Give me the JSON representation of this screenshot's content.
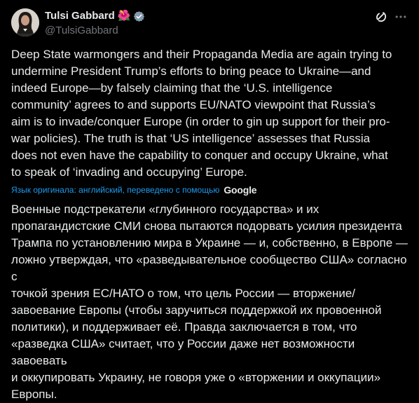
{
  "author": {
    "display_name": "Tulsi Gabbard",
    "flag_emoji": "🌺",
    "handle": "@TulsiGabbard",
    "verified_icon": "verified-badge-icon",
    "avatar_icon": "avatar-photo"
  },
  "actions": {
    "grok_icon": "grok-icon",
    "more_icon": "more-horizontal-icon"
  },
  "tweet": {
    "text": "Deep State warmongers and their Propaganda Media are again trying to\nundermine President Trump’s efforts to bring peace to Ukraine—and\nindeed Europe—by falsely claiming that the ‘U.S. intelligence\ncommunity’ agrees to and supports EU/NATO viewpoint that Russia’s\naim is to invade/conquer Europe (in order to gin up support for their pro-\nwar policies). The truth is that ‘US intelligence’ assesses that Russia\ndoes not even have the capability to conquer and occupy Ukraine, what\nto speak of ‘invading and occupying’ Europe.",
    "translation_note": "Язык оригинала: английский, переведено с помощью",
    "translation_provider": "Google",
    "translated_text": "Военные подстрекатели «глубинного государства» и их\nпропагандистские СМИ снова пытаются подорвать усилия президента\nТрампа по установлению мира в Украине — и, собственно, в Европе —\nложно утверждая, что «разведывательное сообщество США» согласно с\nточкой зрения ЕС/НАТО о том, что цель России — вторжение/\nзавоевание Европы (чтобы заручиться поддержкой их провоенной\nполитики), и поддерживает её. Правда заключается в том, что\n«разведка США» считает, что у России даже нет возможности завоевать\nи оккупировать Украину, не говоря уже о «вторжении и оккупации»\nЕвропы."
  },
  "colors": {
    "background": "#000000",
    "text_primary": "#e7e9ea",
    "text_secondary": "#71767b",
    "accent": "#1d9bf0",
    "verified_badge": "#829aab"
  }
}
